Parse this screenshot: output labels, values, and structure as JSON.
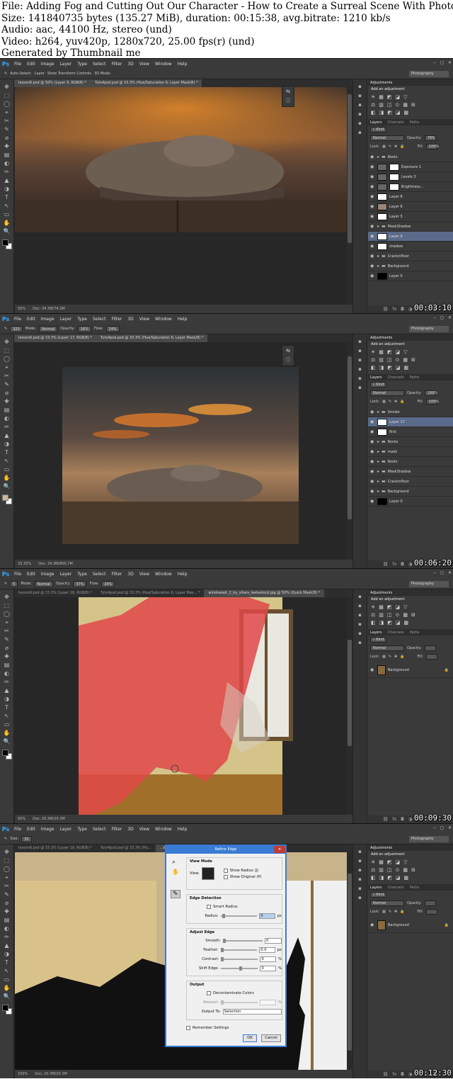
{
  "info": {
    "line1": "File: Adding Fog and Cutting Out Our Character - How to Create a Surreal Scene With Photo Mar",
    "line2": "Size: 141840735 bytes (135.27 MiB), duration: 00:15:38, avg.bitrate: 1210 kb/s",
    "line3": "Audio: aac, 44100 Hz, stereo (und)",
    "line4": "Video: h264, yuv420p, 1280x720, 25.00 fps(r) (und)",
    "line5": "Generated by Thumbnail me"
  },
  "menu": [
    "File",
    "Edit",
    "Image",
    "Layer",
    "Type",
    "Select",
    "Filter",
    "3D",
    "View",
    "Window",
    "Help"
  ],
  "app_logo": "Ps",
  "workspace": "Photography",
  "frames": [
    {
      "timestamp": "00:03:10",
      "options": [
        "Auto-Select:",
        "Layer",
        "Show Transform Controls",
        "3D Mode:"
      ],
      "tabs": [
        "lesson6.psd @ 50% (Layer 9, RGB/8) *",
        "Tuts4psd.psd @ 33.3% (Hue/Saturation 6, Layer Mask/8) *"
      ],
      "zoom": "50%",
      "doc": "Doc: 34.3M/74.2M",
      "adjustments_title": "Adjustments",
      "add_adjustment": "Add an adjustment",
      "layer_tabs": [
        "Layers",
        "Channels",
        "Paths"
      ],
      "kind": "Kind",
      "blend": "Normal",
      "opacity_label": "Opacity:",
      "opacity": "78%",
      "lock_label": "Lock:",
      "fill_label": "Fill:",
      "fill": "100%",
      "layers": [
        {
          "name": "Roots",
          "type": "folder"
        },
        {
          "name": "Exposure 1",
          "type": "adj"
        },
        {
          "name": "Levels 3",
          "type": "adj"
        },
        {
          "name": "Brightness...",
          "type": "adj"
        },
        {
          "name": "Layer 8",
          "type": "layer"
        },
        {
          "name": "Layer 6",
          "type": "layer"
        },
        {
          "name": "Layer 5",
          "type": "layer"
        },
        {
          "name": "MaskShadow",
          "type": "folder"
        },
        {
          "name": "Layer 9",
          "type": "layer",
          "active": true
        },
        {
          "name": "shadow",
          "type": "layer"
        },
        {
          "name": "Crackinfloor",
          "type": "folder"
        },
        {
          "name": "Background",
          "type": "folder"
        },
        {
          "name": "Layer 0",
          "type": "layer"
        }
      ]
    },
    {
      "timestamp": "00:06:20",
      "options": [
        "Mode:",
        "Normal",
        "Opacity:",
        "16%",
        "Flow:",
        "24%"
      ],
      "brush_size": "320",
      "tabs": [
        "lesson6.psd @ 33.3% (Layer 17, RGB/8) *",
        "Tuts4psd.psd @ 33.3% (Hue/Saturation 6, Layer Mask/8) *"
      ],
      "zoom": "33.33%",
      "doc": "Doc: 34.3M/800.7M",
      "adjustments_title": "Adjustments",
      "add_adjustment": "Add an adjustment",
      "layer_tabs": [
        "Layers",
        "Channels",
        "Paths"
      ],
      "kind": "Kind",
      "blend": "Normal",
      "opacity_label": "Opacity:",
      "opacity": "100%",
      "lock_label": "Lock:",
      "fill_label": "Fill:",
      "fill": "100%",
      "layers": [
        {
          "name": "Smoke",
          "type": "folder"
        },
        {
          "name": "Layer 17",
          "type": "layer",
          "active": true
        },
        {
          "name": "first",
          "type": "layer"
        },
        {
          "name": "Rocks",
          "type": "folder"
        },
        {
          "name": "mask",
          "type": "folder"
        },
        {
          "name": "Roots",
          "type": "folder"
        },
        {
          "name": "MaskShadow",
          "type": "folder"
        },
        {
          "name": "Crackinfloor",
          "type": "folder"
        },
        {
          "name": "Background",
          "type": "folder"
        },
        {
          "name": "Layer 0",
          "type": "layer"
        }
      ]
    },
    {
      "timestamp": "00:09:30",
      "options": [
        "Mode:",
        "Normal",
        "Opacity:",
        "37%",
        "Flow:",
        "24%"
      ],
      "brush_size": "5",
      "tabs": [
        "lesson6.psd @ 33.3% (Layer 18, RGB/8) *",
        "Tuts4psd.psd @ 33.3% (Hue/Saturation 6, Layer Mas... *",
        "windswept_2_by_sitara_leetastock.jpg @ 50% (Quick Mask/8) *"
      ],
      "zoom": "50%",
      "doc": "Doc: 20.3M/20.3M",
      "adjustments_title": "Adjustments",
      "add_adjustment": "Add an adjustment",
      "layer_tabs": [
        "Layers",
        "Channels",
        "Paths"
      ],
      "kind": "Kind",
      "blend": "Normal",
      "opacity_label": "Opacity:",
      "opacity": "",
      "lock_label": "Lock:",
      "fill_label": "Fill:",
      "fill": "",
      "layers": [
        {
          "name": "Background",
          "type": "photo"
        }
      ]
    },
    {
      "timestamp": "00:12:30",
      "options": [
        "Size:",
        "35"
      ],
      "tabs": [
        "lesson6.psd @ 33.3% (Layer 18, RGB/8) *",
        "Tuts4psd.psd @ 33.3% (Hu...",
        "...leetastock.jpg @ 100% (RGB/8) *"
      ],
      "zoom": "100%",
      "doc": "Doc: 20.3M/20.3M",
      "adjustments_title": "Adjustments",
      "add_adjustment": "Add an adjustment",
      "layer_tabs": [
        "Layers",
        "Channels",
        "Paths"
      ],
      "kind": "Kind",
      "blend": "Normal",
      "opacity_label": "Opacity:",
      "opacity": "",
      "lock_label": "Lock:",
      "fill_label": "Fill:",
      "fill": "",
      "layers": [
        {
          "name": "Background",
          "type": "photo"
        }
      ]
    }
  ],
  "refine_edge": {
    "title": "Refine Edge",
    "view_mode": "View Mode",
    "view_label": "View:",
    "show_radius": "Show Radius (J)",
    "show_original": "Show Original (P)",
    "edge_detection": "Edge Detection",
    "smart_radius": "Smart Radius",
    "radius_label": "Radius:",
    "radius_value": "0",
    "unit_px": "px",
    "unit_pct": "%",
    "adjust_edge": "Adjust Edge",
    "smooth_label": "Smooth:",
    "smooth_value": "0",
    "feather_label": "Feather:",
    "feather_value": "0.0",
    "contrast_label": "Contrast:",
    "contrast_value": "0",
    "shift_label": "Shift Edge:",
    "shift_value": "0",
    "output": "Output",
    "decontaminate": "Decontaminate Colors",
    "amount_label": "Amount:",
    "output_to_label": "Output To:",
    "output_to_value": "Selection",
    "remember": "Remember Settings",
    "ok": "OK",
    "cancel": "Cancel"
  }
}
